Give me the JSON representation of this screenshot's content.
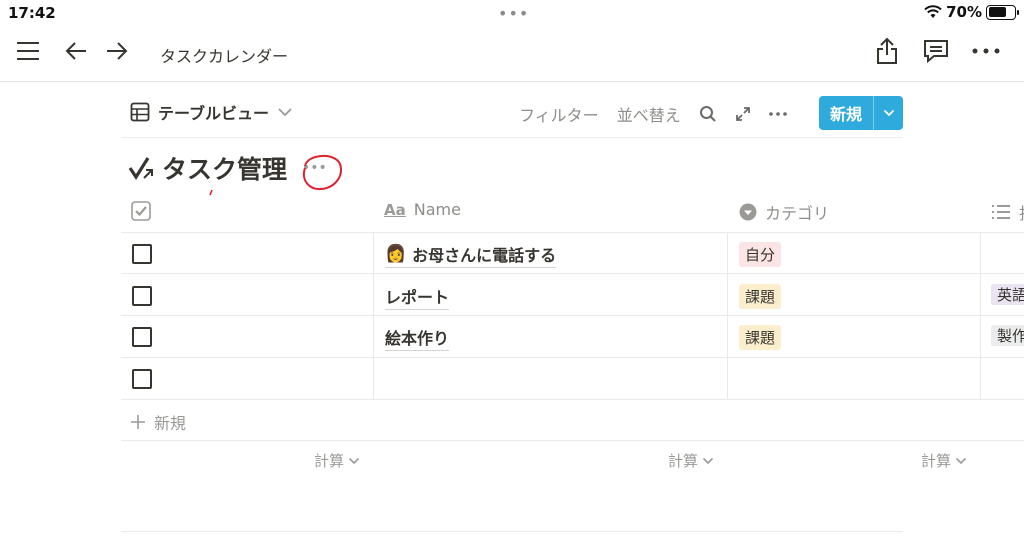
{
  "status_bar": {
    "time": "17:42",
    "dots": "•••",
    "battery_percent": "70%",
    "battery_level": 0.7
  },
  "nav": {
    "title": "タスクカレンダー"
  },
  "toolbar": {
    "view_label": "テーブルビュー",
    "filter_label": "フィルター",
    "sort_label": "並べ替え",
    "new_label": "新規"
  },
  "database": {
    "title": "タスク管理",
    "more": "•••"
  },
  "columns": {
    "name": "Name",
    "category": "カテゴリ",
    "fourth": "担"
  },
  "rows": [
    {
      "name": "お母さんに電話する",
      "emoji": "👩",
      "category": "自分",
      "category_color": "#fbe4e4",
      "extra": "",
      "extra_color": ""
    },
    {
      "name": "レポート",
      "emoji": "",
      "category": "課題",
      "category_color": "#fbeecc",
      "extra": "英語",
      "extra_color": "#eae4f2"
    },
    {
      "name": "絵本作り",
      "emoji": "",
      "category": "課題",
      "category_color": "#fbeecc",
      "extra": "製作",
      "extra_color": "#ebeced"
    },
    {
      "name": "",
      "emoji": "",
      "category": "",
      "category_color": "",
      "extra": "",
      "extra_color": ""
    }
  ],
  "new_row_label": "新規",
  "calc_label": "計算",
  "colors": {
    "accent": "#2eaadc",
    "annotation": "#e0202f"
  }
}
